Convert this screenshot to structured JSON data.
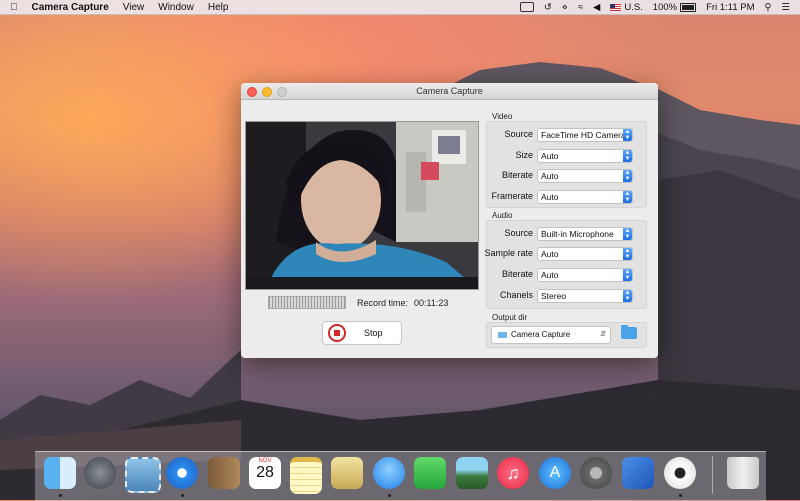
{
  "menubar": {
    "app_name": "Camera Capture",
    "menus": [
      "View",
      "Window",
      "Help"
    ],
    "input_source": "U.S.",
    "battery": "100%",
    "clock": "Fri 1:11 PM"
  },
  "window": {
    "title": "Camera Capture",
    "record_time_label": "Record time:",
    "record_time_value": "00:11:23",
    "stop_label": "Stop"
  },
  "video_group": {
    "label": "Video",
    "source_label": "Source",
    "source_value": "FaceTime HD Camera",
    "size_label": "Size",
    "size_value": "Auto",
    "biterate_label": "Biterate",
    "biterate_value": "Auto",
    "framerate_label": "Framerate",
    "framerate_value": "Auto"
  },
  "audio_group": {
    "label": "Audio",
    "source_label": "Source",
    "source_value": "Built-in Microphone",
    "samplerate_label": "Sample rate",
    "samplerate_value": "Auto",
    "biterate_label": "Biterate",
    "biterate_value": "Auto",
    "chanels_label": "Chanels",
    "chanels_value": "Stereo"
  },
  "output_group": {
    "label": "Output dir",
    "value": "Camera Capture"
  },
  "dock": {
    "items": [
      "finder-icon",
      "launchpad-icon",
      "mail-stamp-icon",
      "safari-icon",
      "contacts-icon",
      "calendar-icon",
      "notes-icon",
      "preview-icon",
      "messages-icon",
      "facetime-icon",
      "photos-icon",
      "itunes-icon",
      "app-store-icon",
      "system-preferences-icon",
      "xcode-icon",
      "camera-capture-icon",
      "trash-icon"
    ],
    "calendar_month": "NOV",
    "calendar_day": "28"
  }
}
